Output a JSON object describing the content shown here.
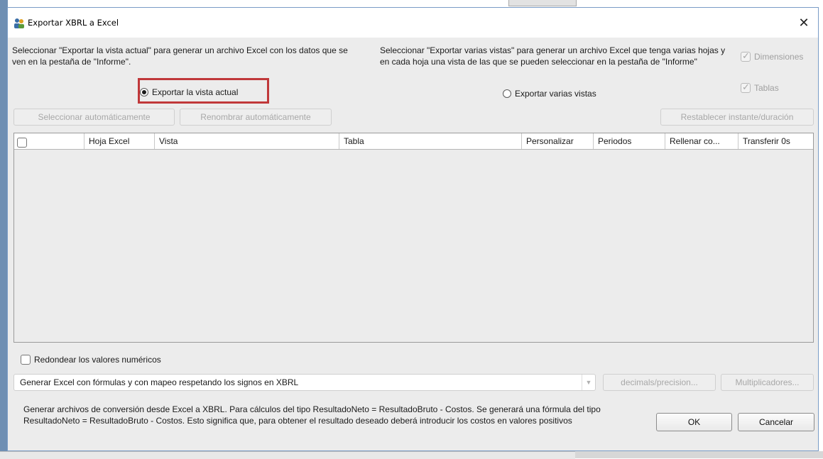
{
  "window": {
    "title": "Exportar XBRL a Excel",
    "close_glyph": "✕",
    "app_icon": "people-icon"
  },
  "export_current": {
    "description": "Seleccionar \"Exportar la vista actual\" para generar un archivo Excel con los datos que se ven en la pestaña de \"Informe\".",
    "option_label": "Exportar la vista actual",
    "selected": true
  },
  "export_multiple": {
    "description": "Seleccionar \"Exportar varias vistas\" para generar un archivo Excel que tenga varias hojas y en cada hoja una vista de las que se pueden seleccionar en la pestaña de \"Informe\"",
    "option_label": "Exportar varias vistas",
    "selected": false
  },
  "options": {
    "dimensiones_label": "Dimensiones",
    "tablas_label": "Tablas"
  },
  "toolbar": {
    "auto_select_label": "Seleccionar automáticamente",
    "auto_rename_label": "Renombrar automáticamente",
    "reset_label": "Restablecer instante/duración"
  },
  "table": {
    "columns": [
      "",
      "Hoja Excel",
      "Vista",
      "Tabla",
      "Personalizar",
      "Periodos",
      "Rellenar co...",
      "Transferir 0s"
    ],
    "rows": []
  },
  "round_label": "Redondear los valores numéricos",
  "mode_select": {
    "value": "Generar Excel con fórmulas y con mapeo respetando los signos en XBRL"
  },
  "buttons": {
    "decimals_label": "decimals/precision...",
    "multipliers_label": "Multiplicadores...",
    "ok_label": "OK",
    "cancel_label": "Cancelar"
  },
  "footer_note": "Generar archivos de conversión desde Excel a XBRL. Para cálculos del tipo ResultadoNeto = ResultadoBruto - Costos. Se generará una fórmula del tipo ResultadoNeto = ResultadoBruto - Costos. Esto significa que, para obtener el resultado deseado deberá introducir los costos en valores positivos",
  "colors": {
    "highlight_border": "#c0383a",
    "dialog_background": "#ececec",
    "window_border": "#7a9cc6"
  }
}
